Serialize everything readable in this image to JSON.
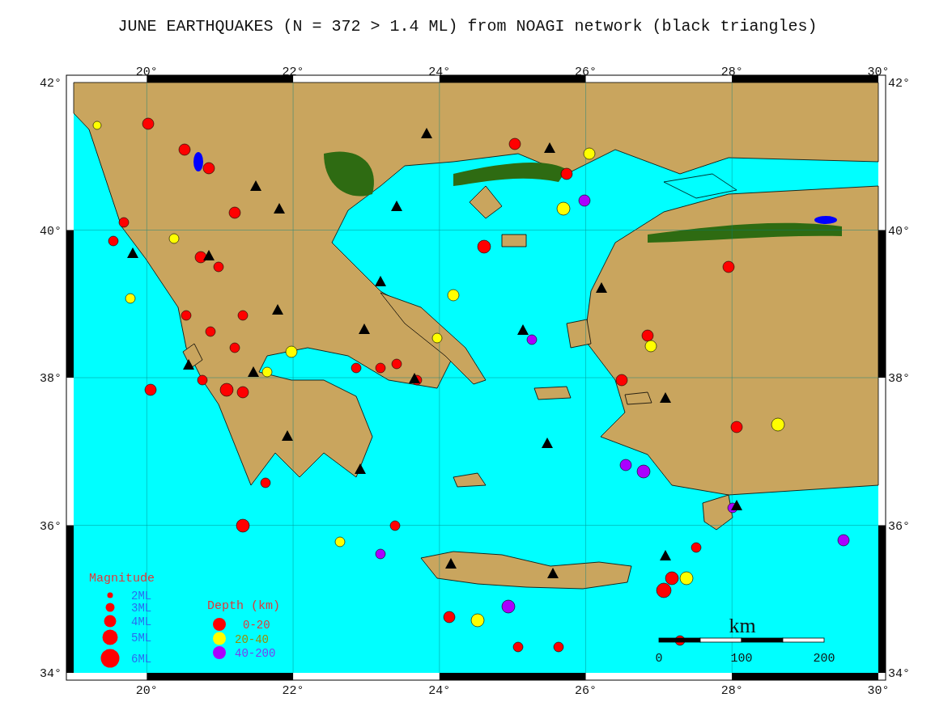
{
  "title": "JUNE EARTHQUAKES (N = 372 > 1.4 ML) from NOAGI network (black triangles)",
  "map": {
    "top_ticks": [
      "20°",
      "22°",
      "24°",
      "26°",
      "28°",
      "30°"
    ],
    "bottom_ticks": [
      "20°",
      "22°",
      "24°",
      "26°",
      "28°",
      "30°"
    ],
    "left_ticks": [
      "42°",
      "40°",
      "38°",
      "36°",
      "34°"
    ],
    "right_ticks": [
      "42°",
      "40°",
      "38°",
      "36°",
      "34°"
    ]
  },
  "magnitude_legend": {
    "title": "Magnitude",
    "items": [
      {
        "label": "2ML"
      },
      {
        "label": "3ML"
      },
      {
        "label": "4ML"
      },
      {
        "label": "5ML"
      },
      {
        "label": "6ML"
      }
    ]
  },
  "depth_legend": {
    "title": "Depth (km)",
    "items": [
      {
        "label": "0-20",
        "color": "#ff0000"
      },
      {
        "label": "20-40",
        "color": "#ffff00"
      },
      {
        "label": "40-200",
        "color": "#aa00ff"
      }
    ]
  },
  "scale_bar": {
    "unit": "km",
    "ticks": [
      "0",
      "100",
      "200"
    ]
  }
}
